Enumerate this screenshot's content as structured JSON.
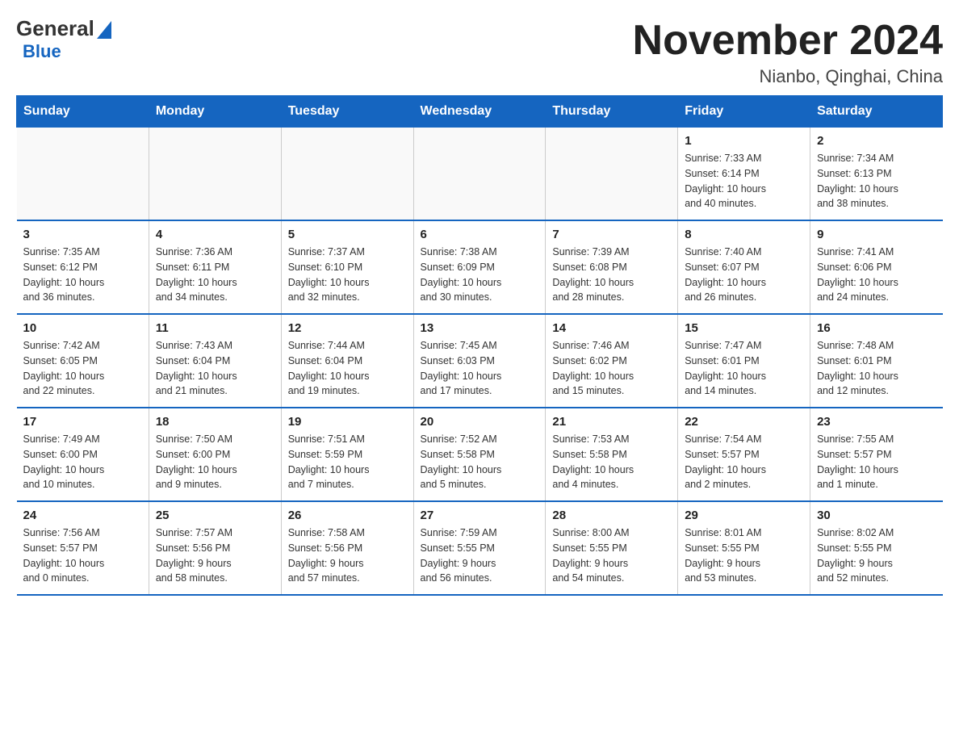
{
  "header": {
    "logo": {
      "general": "General",
      "blue": "Blue"
    },
    "title": "November 2024",
    "location": "Nianbo, Qinghai, China"
  },
  "days_of_week": [
    "Sunday",
    "Monday",
    "Tuesday",
    "Wednesday",
    "Thursday",
    "Friday",
    "Saturday"
  ],
  "weeks": [
    [
      {
        "day": "",
        "info": ""
      },
      {
        "day": "",
        "info": ""
      },
      {
        "day": "",
        "info": ""
      },
      {
        "day": "",
        "info": ""
      },
      {
        "day": "",
        "info": ""
      },
      {
        "day": "1",
        "info": "Sunrise: 7:33 AM\nSunset: 6:14 PM\nDaylight: 10 hours\nand 40 minutes."
      },
      {
        "day": "2",
        "info": "Sunrise: 7:34 AM\nSunset: 6:13 PM\nDaylight: 10 hours\nand 38 minutes."
      }
    ],
    [
      {
        "day": "3",
        "info": "Sunrise: 7:35 AM\nSunset: 6:12 PM\nDaylight: 10 hours\nand 36 minutes."
      },
      {
        "day": "4",
        "info": "Sunrise: 7:36 AM\nSunset: 6:11 PM\nDaylight: 10 hours\nand 34 minutes."
      },
      {
        "day": "5",
        "info": "Sunrise: 7:37 AM\nSunset: 6:10 PM\nDaylight: 10 hours\nand 32 minutes."
      },
      {
        "day": "6",
        "info": "Sunrise: 7:38 AM\nSunset: 6:09 PM\nDaylight: 10 hours\nand 30 minutes."
      },
      {
        "day": "7",
        "info": "Sunrise: 7:39 AM\nSunset: 6:08 PM\nDaylight: 10 hours\nand 28 minutes."
      },
      {
        "day": "8",
        "info": "Sunrise: 7:40 AM\nSunset: 6:07 PM\nDaylight: 10 hours\nand 26 minutes."
      },
      {
        "day": "9",
        "info": "Sunrise: 7:41 AM\nSunset: 6:06 PM\nDaylight: 10 hours\nand 24 minutes."
      }
    ],
    [
      {
        "day": "10",
        "info": "Sunrise: 7:42 AM\nSunset: 6:05 PM\nDaylight: 10 hours\nand 22 minutes."
      },
      {
        "day": "11",
        "info": "Sunrise: 7:43 AM\nSunset: 6:04 PM\nDaylight: 10 hours\nand 21 minutes."
      },
      {
        "day": "12",
        "info": "Sunrise: 7:44 AM\nSunset: 6:04 PM\nDaylight: 10 hours\nand 19 minutes."
      },
      {
        "day": "13",
        "info": "Sunrise: 7:45 AM\nSunset: 6:03 PM\nDaylight: 10 hours\nand 17 minutes."
      },
      {
        "day": "14",
        "info": "Sunrise: 7:46 AM\nSunset: 6:02 PM\nDaylight: 10 hours\nand 15 minutes."
      },
      {
        "day": "15",
        "info": "Sunrise: 7:47 AM\nSunset: 6:01 PM\nDaylight: 10 hours\nand 14 minutes."
      },
      {
        "day": "16",
        "info": "Sunrise: 7:48 AM\nSunset: 6:01 PM\nDaylight: 10 hours\nand 12 minutes."
      }
    ],
    [
      {
        "day": "17",
        "info": "Sunrise: 7:49 AM\nSunset: 6:00 PM\nDaylight: 10 hours\nand 10 minutes."
      },
      {
        "day": "18",
        "info": "Sunrise: 7:50 AM\nSunset: 6:00 PM\nDaylight: 10 hours\nand 9 minutes."
      },
      {
        "day": "19",
        "info": "Sunrise: 7:51 AM\nSunset: 5:59 PM\nDaylight: 10 hours\nand 7 minutes."
      },
      {
        "day": "20",
        "info": "Sunrise: 7:52 AM\nSunset: 5:58 PM\nDaylight: 10 hours\nand 5 minutes."
      },
      {
        "day": "21",
        "info": "Sunrise: 7:53 AM\nSunset: 5:58 PM\nDaylight: 10 hours\nand 4 minutes."
      },
      {
        "day": "22",
        "info": "Sunrise: 7:54 AM\nSunset: 5:57 PM\nDaylight: 10 hours\nand 2 minutes."
      },
      {
        "day": "23",
        "info": "Sunrise: 7:55 AM\nSunset: 5:57 PM\nDaylight: 10 hours\nand 1 minute."
      }
    ],
    [
      {
        "day": "24",
        "info": "Sunrise: 7:56 AM\nSunset: 5:57 PM\nDaylight: 10 hours\nand 0 minutes."
      },
      {
        "day": "25",
        "info": "Sunrise: 7:57 AM\nSunset: 5:56 PM\nDaylight: 9 hours\nand 58 minutes."
      },
      {
        "day": "26",
        "info": "Sunrise: 7:58 AM\nSunset: 5:56 PM\nDaylight: 9 hours\nand 57 minutes."
      },
      {
        "day": "27",
        "info": "Sunrise: 7:59 AM\nSunset: 5:55 PM\nDaylight: 9 hours\nand 56 minutes."
      },
      {
        "day": "28",
        "info": "Sunrise: 8:00 AM\nSunset: 5:55 PM\nDaylight: 9 hours\nand 54 minutes."
      },
      {
        "day": "29",
        "info": "Sunrise: 8:01 AM\nSunset: 5:55 PM\nDaylight: 9 hours\nand 53 minutes."
      },
      {
        "day": "30",
        "info": "Sunrise: 8:02 AM\nSunset: 5:55 PM\nDaylight: 9 hours\nand 52 minutes."
      }
    ]
  ]
}
